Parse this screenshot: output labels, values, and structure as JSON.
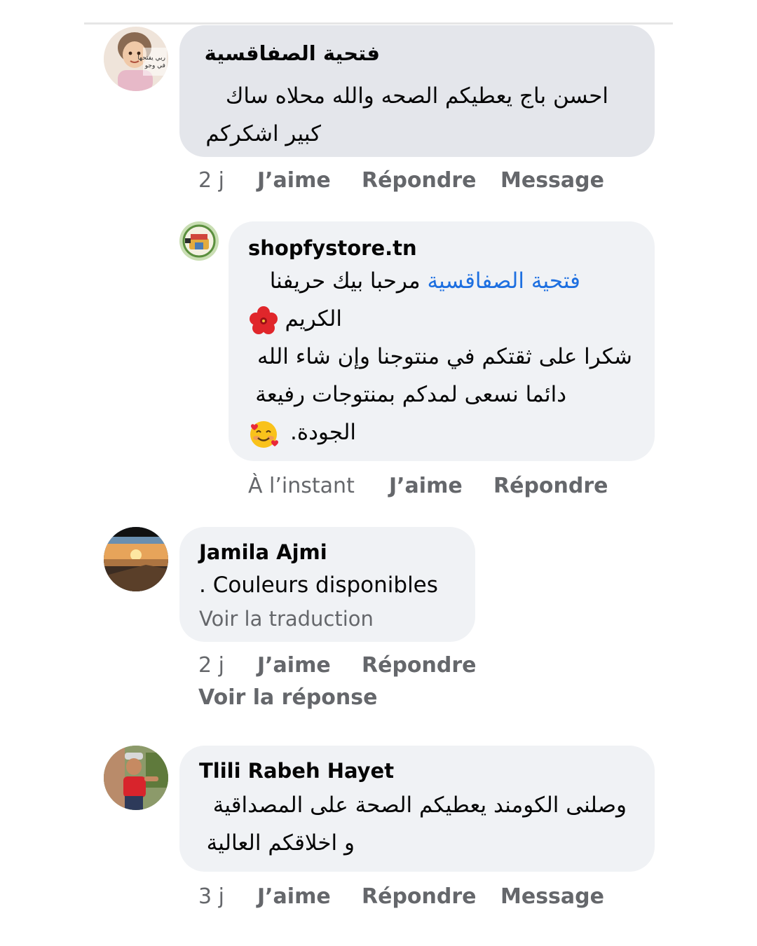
{
  "comments": [
    {
      "author": "فتحية الصفاقسية",
      "avatar_icon": "child-photo-avatar",
      "avatar_caption": "ربي يفتحها في وجو",
      "lines": [
        "احسن  باج  يعطيكم الصحه والله محلاه ساك",
        "كبير  اشكركم"
      ],
      "time": "2 j",
      "like": "J’aime",
      "reply": "Répondre",
      "message": "Message"
    },
    {
      "author": "shopfystore.tn",
      "avatar_icon": "shopfystore-logo-avatar",
      "mention": "فتحية الصفاقسية",
      "lines": [
        "مرحبا بيك حريفنا",
        "الكريم",
        "شكرا على ثقتكم في منتوجنا وإن شاء الله",
        "دائما نسعى لمدكم بمنتوجات رفيعة",
        "الجودة."
      ],
      "emojis": [
        "hibiscus-emoji",
        "smiling-face-with-hearts-emoji"
      ],
      "time": "À l’instant",
      "like": "J’aime",
      "reply": "Répondre"
    },
    {
      "author": "Jamila Ajmi",
      "avatar_icon": "sunset-photo-avatar",
      "text": ". Couleurs disponibles",
      "translate": "Voir la traduction",
      "time": "2 j",
      "like": "J’aime",
      "reply": "Répondre",
      "view_reply": "Voir la réponse"
    },
    {
      "author": "Tlili Rabeh Hayet",
      "avatar_icon": "boy-photo-avatar",
      "lines": [
        "وصلنى الكومند يعطيكم الصحة على المصداقية",
        "و اخلاقكم العالية"
      ],
      "time": "3 j",
      "like": "J’aime",
      "reply": "Répondre",
      "message": "Message"
    }
  ],
  "colors": {
    "bubble_first": "#e4e6eb",
    "bubble": "#f0f2f5",
    "meta_text": "#65676b",
    "mention_link": "#1d6fe0"
  }
}
